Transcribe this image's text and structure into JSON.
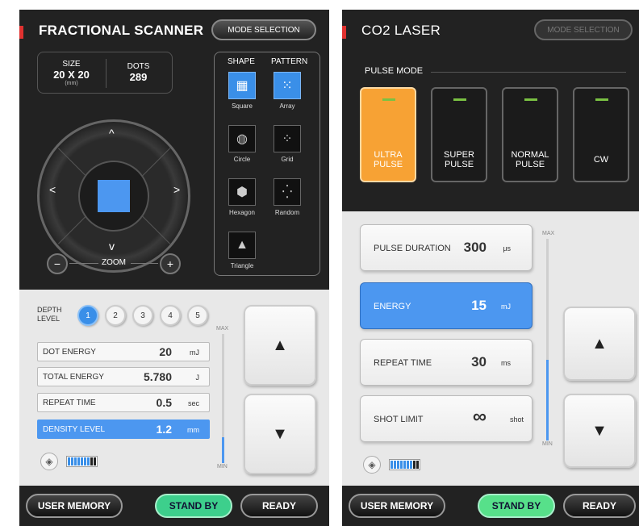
{
  "left": {
    "title": "FRACTIONAL SCANNER",
    "mode_button": "MODE SELECTION",
    "size": {
      "label": "SIZE",
      "value": "20 X 20",
      "unit": "(mm)"
    },
    "dots": {
      "label": "DOTS",
      "value": "289"
    },
    "shape_header": "SHAPE",
    "pattern_header": "PATTERN",
    "shapes": [
      "Square",
      "Circle",
      "Hexagon",
      "Triangle"
    ],
    "patterns": [
      "Array",
      "Grid",
      "Random"
    ],
    "selected_shape": "Square",
    "selected_pattern": "Array",
    "zoom_label": "ZOOM",
    "zoom_minus": "−",
    "zoom_plus": "+",
    "depth_label_1": "DEPTH",
    "depth_label_2": "LEVEL",
    "depth_levels": [
      "1",
      "2",
      "3",
      "4",
      "5"
    ],
    "depth_selected": "1",
    "params": [
      {
        "name": "DOT ENERGY",
        "value": "20",
        "unit": "mJ"
      },
      {
        "name": "TOTAL ENERGY",
        "value": "5.780",
        "unit": "J"
      },
      {
        "name": "REPEAT TIME",
        "value": "0.5",
        "unit": "sec"
      },
      {
        "name": "DENSITY LEVEL",
        "value": "1.2",
        "unit": "mm"
      }
    ],
    "selected_param": "DENSITY LEVEL",
    "scale_max": "MAX",
    "scale_min": "MIN",
    "level_fraction": 0.2,
    "up_icon": "▲",
    "down_icon": "▼",
    "bottom": {
      "user_memory": "USER MEMORY",
      "stand_by": "STAND BY",
      "ready": "READY"
    }
  },
  "right": {
    "title": "CO2 LASER",
    "mode_button": "MODE SELECTION",
    "pulse_mode_label": "PULSE MODE",
    "pulse_modes": [
      {
        "line1": "ULTRA",
        "line2": "PULSE"
      },
      {
        "line1": "SUPER",
        "line2": "PULSE"
      },
      {
        "line1": "NORMAL",
        "line2": "PULSE"
      },
      {
        "line1": "CW",
        "line2": ""
      }
    ],
    "selected_pulse_mode": "ULTRA PULSE",
    "params": [
      {
        "name": "PULSE DURATION",
        "value": "300",
        "unit": "μs"
      },
      {
        "name": "ENERGY",
        "value": "15",
        "unit": "mJ"
      },
      {
        "name": "REPEAT TIME",
        "value": "30",
        "unit": "ms"
      },
      {
        "name": "SHOT LIMIT",
        "value": "∞",
        "unit": "shot"
      }
    ],
    "selected_param": "ENERGY",
    "scale_max": "MAX",
    "scale_min": "MIN",
    "level_fraction": 0.4,
    "up_icon": "▲",
    "down_icon": "▼",
    "bottom": {
      "user_memory": "USER MEMORY",
      "stand_by": "STAND BY",
      "ready": "READY"
    }
  },
  "colors": {
    "accent_blue": "#4c97f0",
    "accent_orange": "#f7a234",
    "standby_green": "#3dcf8c",
    "title_red": "#e0312f"
  }
}
